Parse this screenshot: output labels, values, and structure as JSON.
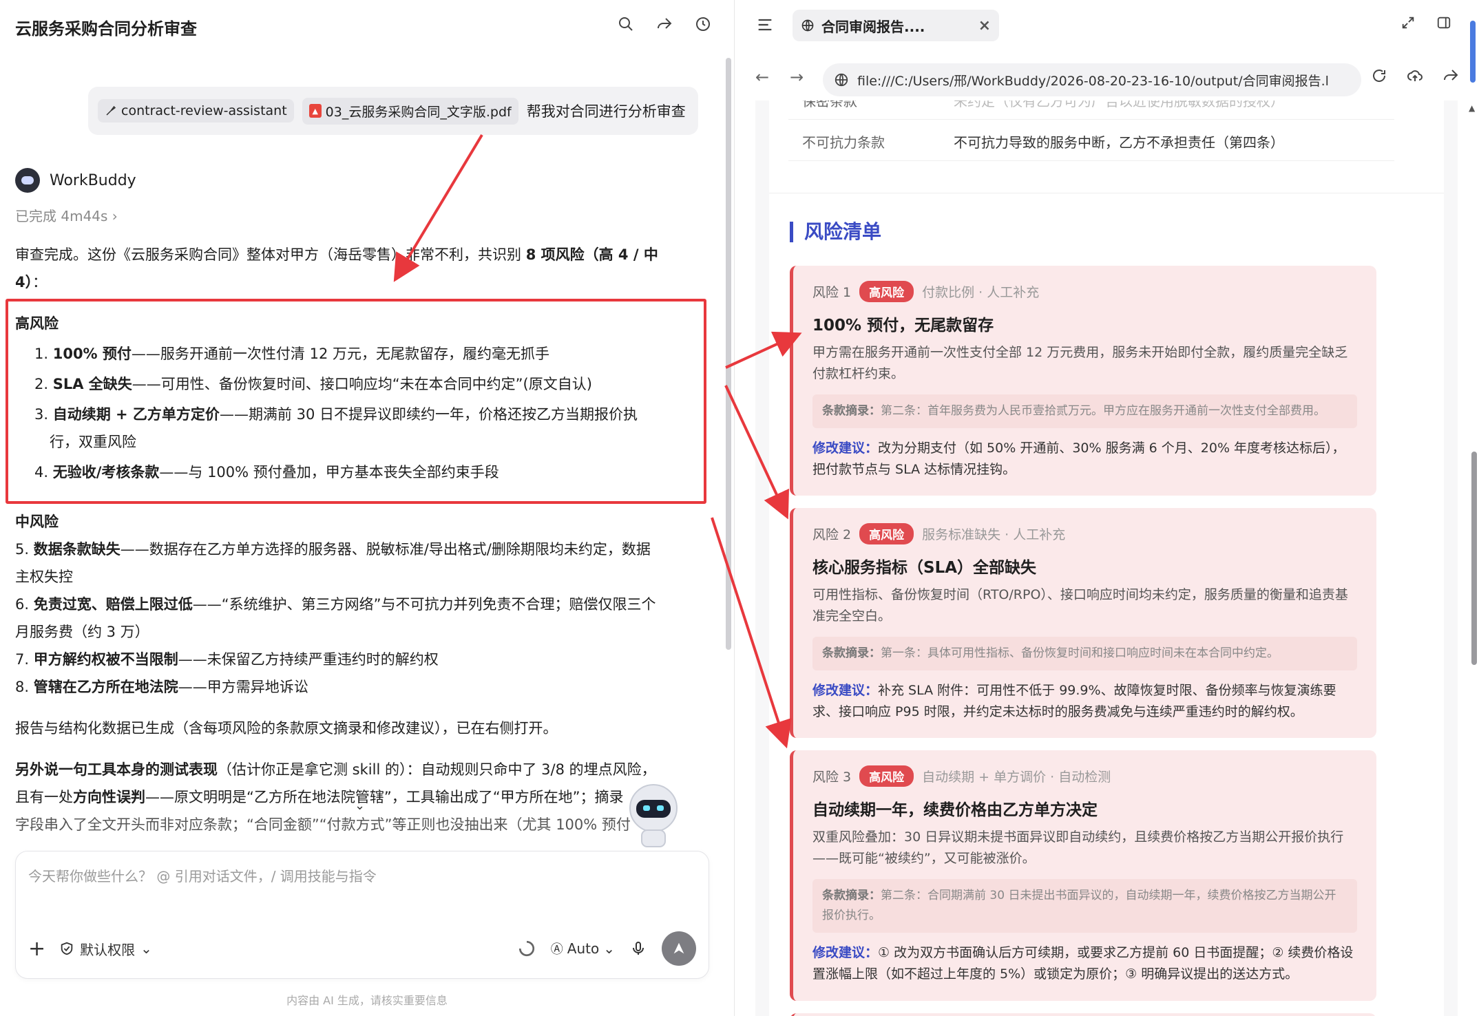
{
  "left": {
    "title": "云服务采购合同分析审查",
    "user_message": {
      "skill_chip": "contract-review-assistant",
      "file_chip": "03_云服务采购合同_文字版.pdf",
      "text": "帮我对合同进行分析审查"
    },
    "bot": {
      "name": "WorkBuddy",
      "status": "已完成 4m44s"
    },
    "reply": {
      "intro_a": "审查完成。这份《云服务采购合同》整体对甲方（海岳零售）非常不利，共识别 ",
      "intro_b": "8 项风险（高 4 / 中",
      "intro_c": "4）",
      "intro_d": "：",
      "high_heading": "高风险",
      "high_items": [
        {
          "num": "1. ",
          "bold": "100% 预付",
          "rest": "——服务开通前一次性付清 12 万元，无尾款留存，履约毫无抓手"
        },
        {
          "num": "2. ",
          "bold": "SLA 全缺失",
          "rest": "——可用性、备份恢复时间、接口响应均“未在本合同中约定”(原文自认)"
        },
        {
          "num": "3. ",
          "bold": "自动续期 + 乙方单方定价",
          "rest": "——期满前 30 日不提异议即续约一年，价格还按乙方当期报价执"
        },
        {
          "num": "",
          "bold": "",
          "rest": "行，双重风险"
        },
        {
          "num": "4. ",
          "bold": "无验收/考核条款",
          "rest": "——与 100% 预付叠加，甲方基本丧失全部约束手段"
        }
      ],
      "mid_heading": "中风险",
      "mid_items": [
        {
          "num": "5. ",
          "bold": "数据条款缺失",
          "rest": "——数据存在乙方单方选择的服务器、脱敏标准/导出格式/删除期限均未约定，数据"
        },
        {
          "num": "",
          "bold": "",
          "rest": "主权失控"
        },
        {
          "num": "6. ",
          "bold": "免责过宽、赔偿上限过低",
          "rest": "——“系统维护、第三方网络”与不可抗力并列免责不合理；赔偿仅限三个"
        },
        {
          "num": "",
          "bold": "",
          "rest": "月服务费（约 3 万）"
        },
        {
          "num": "7. ",
          "bold": "甲方解约权被不当限制",
          "rest": "——未保留乙方持续严重违约时的解约权"
        },
        {
          "num": "8. ",
          "bold": "管辖在乙方所在地法院",
          "rest": "——甲方需异地诉讼"
        }
      ],
      "report_line": "报告与结构化数据已生成（含每项风险的条款原文摘录和修改建议），已在右侧打开。",
      "extra_bold": "另外说一句工具本身的测试表现",
      "extra_a": "（估计你正是拿它测 skill 的）：自动规则只命中了 3/8 的埋点风险，",
      "extra_b_pre": "且有一处",
      "extra_b_bold": "方向性误判",
      "extra_b_post": "——原文明明是“乙方所在地法院管辖”，工具输出成了“甲方所在地”；摘录",
      "extra_c": "字段串入了全文开头而非对应条款；“合同金额”“付款方式”等正则也没抽出来（尤其 100% 预付"
    },
    "input": {
      "placeholder": "今天帮你做些什么？ @ 引用对话文件，/ 调用技能与指令",
      "permission": "默认权限",
      "model": "Auto"
    },
    "disclaimer": "内容由 AI 生成，请核实重要信息"
  },
  "browser": {
    "tab_title": "合同审阅报告....",
    "url": "file:///C:/Users/邢/WorkBuddy/2026-08-20-23-16-10/output/合同审阅报告.l",
    "kv_partial_key": "保密条款",
    "kv_partial_val": "未约定（仅有乙方可为广告以近使用脱敏数据的授权）",
    "kv_key": "不可抗力条款",
    "kv_val": "不可抗力导致的服务中断，乙方不承担责任（第四条）",
    "section_title": "风险清单",
    "risks": [
      {
        "no": "风险 1",
        "tag": "高风险",
        "meta": "付款比例 · 人工补充",
        "title": "100% 预付，无尾款留存",
        "desc": "甲方需在服务开通前一次性支付全部 12 万元费用，服务未开始即付全款，履约质量完全缺乏付款杠杆约束。",
        "clause_label": "条款摘录：",
        "clause": "第二条：首年服务费为人民币壹拾贰万元。甲方应在服务开通前一次性支付全部费用。",
        "fix_label": "修改建议：",
        "fix": "改为分期支付（如 50% 开通前、30% 服务满 6 个月、20% 年度考核达标后），把付款节点与 SLA 达标情况挂钩。"
      },
      {
        "no": "风险 2",
        "tag": "高风险",
        "meta": "服务标准缺失 · 人工补充",
        "title": "核心服务指标（SLA）全部缺失",
        "desc": "可用性指标、备份恢复时间（RTO/RPO）、接口响应时间均未约定，服务质量的衡量和追责基准完全空白。",
        "clause_label": "条款摘录：",
        "clause": "第一条：具体可用性指标、备份恢复时间和接口响应时间未在本合同中约定。",
        "fix_label": "修改建议：",
        "fix": "补充 SLA 附件：可用性不低于 99.9%、故障恢复时限、备份频率与恢复演练要求、接口响应 P95 时限，并约定未达标时的服务费减免与连续严重违约时的解约权。"
      },
      {
        "no": "风险 3",
        "tag": "高风险",
        "meta": "自动续期 + 单方调价 · 自动检测",
        "title": "自动续期一年，续费价格由乙方单方决定",
        "desc": "双重风险叠加：30 日异议期未提书面异议即自动续约，且续费价格按乙方当期公开报价执行——既可能“被续约”，又可能被涨价。",
        "clause_label": "条款摘录：",
        "clause": "第二条：合同期满前 30 日未提出书面异议的，自动续期一年，续费价格按乙方当期公开报价执行。",
        "fix_label": "修改建议：",
        "fix": "① 改为双方书面确认后方可续期，或要求乙方提前 60 日书面提醒；② 续费价格设置涨幅上限（如不超过上年度的 5%）或锁定为原价；③ 明确异议提出的送达方式。"
      }
    ]
  }
}
